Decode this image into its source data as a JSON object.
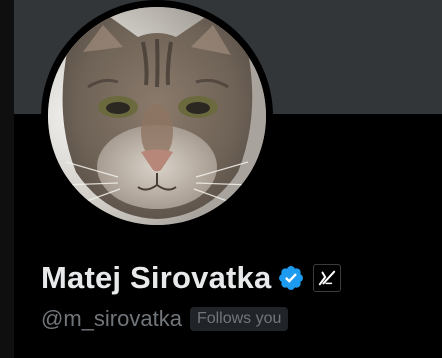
{
  "profile": {
    "display_name": "Matej Sirovatka",
    "handle": "@m_sirovatka",
    "follows_you_label": "Follows you",
    "verified": true
  },
  "icons": {
    "verified": "verified-checkmark-icon",
    "affiliate": "affiliate-logo-icon"
  },
  "colors": {
    "banner": "#333639",
    "background": "#000000",
    "primary_text": "#e7e9ea",
    "secondary_text": "#71767b",
    "verified_blue": "#1d9bf0"
  }
}
